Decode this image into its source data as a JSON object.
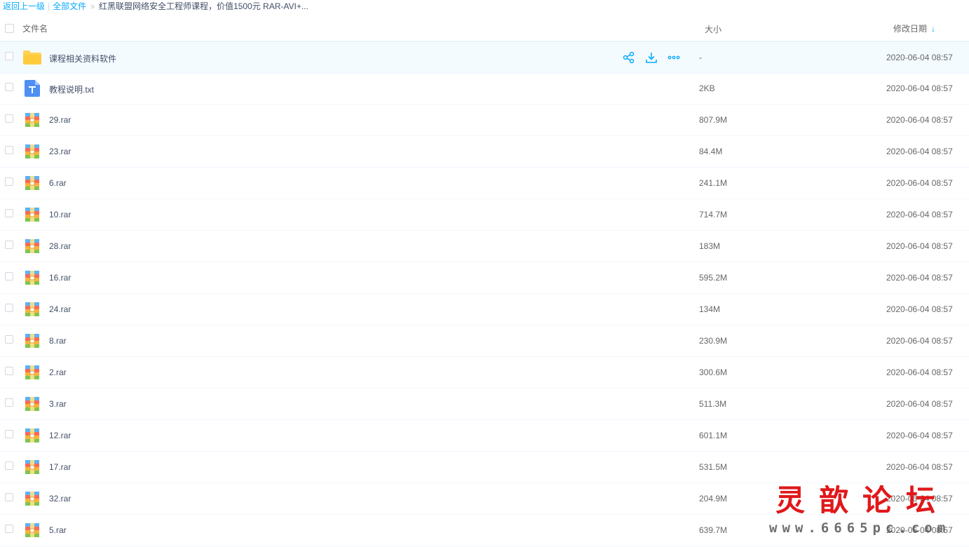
{
  "breadcrumb": {
    "back": "返回上一级",
    "all_files": "全部文件",
    "arrow": ">",
    "current": "红黑联盟网络安全工程师课程，价值1500元 RAR-AVI+..."
  },
  "columns": {
    "name": "文件名",
    "size": "大小",
    "date": "修改日期",
    "sort_icon": "arrow-down-icon"
  },
  "accent_color": "#09aaff",
  "files": [
    {
      "name": "课程相关资料软件",
      "size": "-",
      "date": "2020-06-04 08:57",
      "type": "folder"
    },
    {
      "name": "教程说明.txt",
      "size": "2KB",
      "date": "2020-06-04 08:57",
      "type": "txt"
    },
    {
      "name": "29.rar",
      "size": "807.9M",
      "date": "2020-06-04 08:57",
      "type": "rar"
    },
    {
      "name": "23.rar",
      "size": "84.4M",
      "date": "2020-06-04 08:57",
      "type": "rar"
    },
    {
      "name": "6.rar",
      "size": "241.1M",
      "date": "2020-06-04 08:57",
      "type": "rar"
    },
    {
      "name": "10.rar",
      "size": "714.7M",
      "date": "2020-06-04 08:57",
      "type": "rar"
    },
    {
      "name": "28.rar",
      "size": "183M",
      "date": "2020-06-04 08:57",
      "type": "rar"
    },
    {
      "name": "16.rar",
      "size": "595.2M",
      "date": "2020-06-04 08:57",
      "type": "rar"
    },
    {
      "name": "24.rar",
      "size": "134M",
      "date": "2020-06-04 08:57",
      "type": "rar"
    },
    {
      "name": "8.rar",
      "size": "230.9M",
      "date": "2020-06-04 08:57",
      "type": "rar"
    },
    {
      "name": "2.rar",
      "size": "300.6M",
      "date": "2020-06-04 08:57",
      "type": "rar"
    },
    {
      "name": "3.rar",
      "size": "511.3M",
      "date": "2020-06-04 08:57",
      "type": "rar"
    },
    {
      "name": "12.rar",
      "size": "601.1M",
      "date": "2020-06-04 08:57",
      "type": "rar"
    },
    {
      "name": "17.rar",
      "size": "531.5M",
      "date": "2020-06-04 08:57",
      "type": "rar"
    },
    {
      "name": "32.rar",
      "size": "204.9M",
      "date": "2020-06-04 08:57",
      "type": "rar"
    },
    {
      "name": "5.rar",
      "size": "639.7M",
      "date": "2020-06-04 08:57",
      "type": "rar"
    }
  ],
  "row_actions": [
    "share-icon",
    "download-icon",
    "more-icon"
  ],
  "watermark": {
    "line1": "灵歆论坛",
    "line2": "www.6665pc.com"
  }
}
